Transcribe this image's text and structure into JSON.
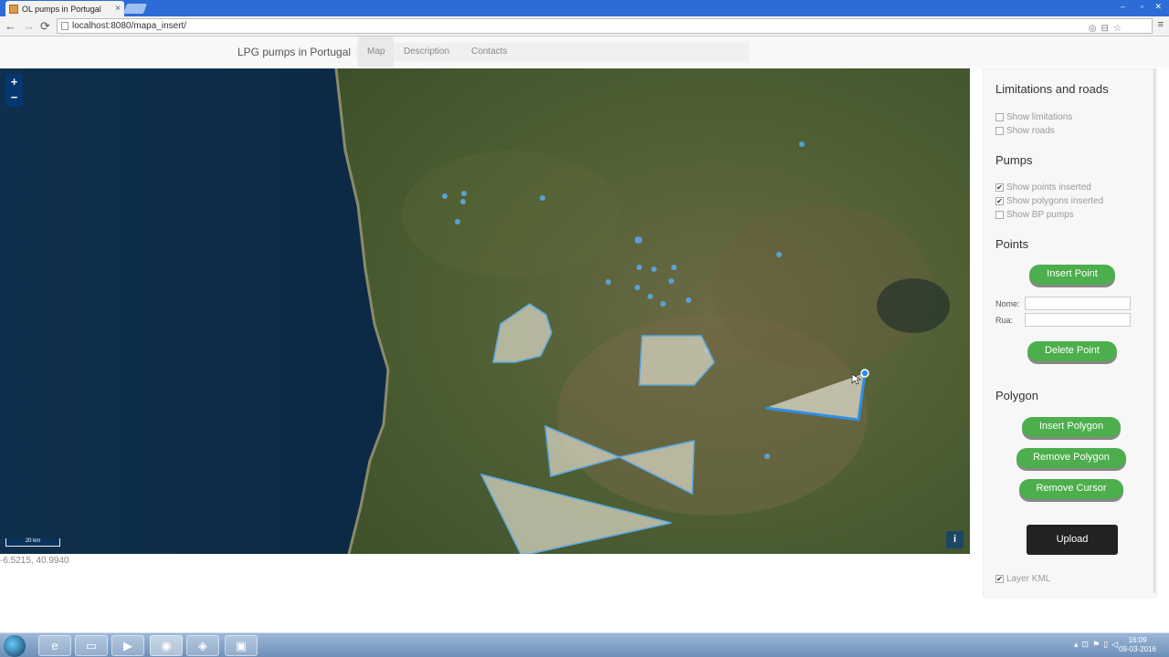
{
  "browser": {
    "tab_title": "OL pumps in Portugal",
    "tab_close": "×",
    "url": "localhost:8080/mapa_insert/",
    "back": "←",
    "forward": "→",
    "reload": "⟳",
    "window_controls": [
      "‒",
      "▫",
      "✕"
    ]
  },
  "site": {
    "brand": "LPG pumps in Portugal",
    "nav": [
      {
        "label": "Map",
        "active": true
      },
      {
        "label": "Description",
        "active": false
      },
      {
        "label": "Contacts",
        "active": false
      }
    ]
  },
  "map": {
    "zoom_in": "+",
    "zoom_out": "−",
    "scale_label": "20 km",
    "info": "i",
    "coordinates": "-6.5215, 40.9940"
  },
  "panel": {
    "limits_title": "Limitations and roads",
    "show_limitations": {
      "label": "Show limitations",
      "checked": false
    },
    "show_roads": {
      "label": "Show roads",
      "checked": false
    },
    "pumps_title": "Pumps",
    "show_points": {
      "label": "Show points inserted",
      "checked": true
    },
    "show_polygons": {
      "label": "Show polygons inserted",
      "checked": true
    },
    "show_bp": {
      "label": "Show BP pumps",
      "checked": false
    },
    "points_title": "Points",
    "insert_point": "Insert Point",
    "nome_label": "Nome:",
    "nome_value": "",
    "rua_label": "Rua:",
    "rua_value": "",
    "delete_point": "Delete Point",
    "polygon_title": "Polygon",
    "insert_polygon": "Insert Polygon",
    "remove_polygon": "Remove Polygon",
    "remove_cursor": "Remove Cursor",
    "upload": "Upload",
    "layer_kml": {
      "label": "Layer KML",
      "checked": true
    }
  },
  "taskbar": {
    "time": "16:09",
    "date": "09-03-2016"
  },
  "colors": {
    "ocean": "#0b2a45",
    "land": "#4a5a32",
    "polygon_fill": "#c9c6b4",
    "polygon_stroke": "#5aa9e6",
    "green_button": "#4cae4c"
  }
}
